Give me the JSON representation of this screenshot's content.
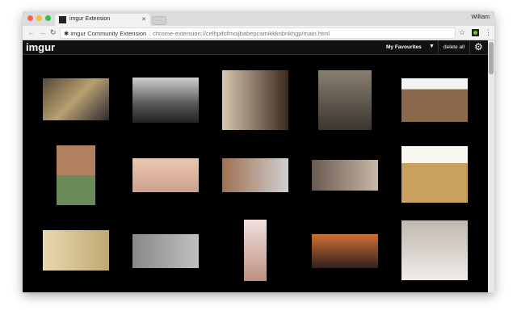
{
  "browser": {
    "tab_title": "imgur Extension",
    "user": "William",
    "site_name": "imgur Community Extension",
    "url": "chrome-extension://celhpifofmoijbabepcamikkknbnkhgp/main.html"
  },
  "header": {
    "logo": "imgur",
    "album_select": "My Favourites",
    "delete_label": "delete all"
  },
  "colors": {
    "background": "#000000",
    "header": "#111111"
  },
  "gallery": [
    {
      "fill": "linear-gradient(135deg,#5a4a3a,#b8a070,#2a2a30)"
    },
    {
      "fill": "linear-gradient(180deg,#cfcfcf,#555 60%,#222)"
    },
    {
      "fill": "linear-gradient(90deg,#d8c8b0,#3a2a20)"
    },
    {
      "fill": "linear-gradient(180deg,#8a8070,#3a3530)"
    },
    {
      "fill": "linear-gradient(180deg,#f4f4f4 25%,#8a6a4a 25%)"
    },
    {
      "fill": "linear-gradient(180deg,#b08060 50%,#6a8a5a 50%)"
    },
    {
      "fill": "linear-gradient(180deg,#e8c8b0,#d0a090)"
    },
    {
      "fill": "linear-gradient(90deg,#a07050,#d0d0d0)"
    },
    {
      "fill": "linear-gradient(90deg,#6a5a50,#c8b8a8)"
    },
    {
      "fill": "linear-gradient(180deg,#f8f8f0 30%,#c8a060 30%)"
    },
    {
      "fill": "linear-gradient(90deg,#e8d8b0,#c0a870)"
    },
    {
      "fill": "linear-gradient(90deg,#888,#c0c0c0)"
    },
    {
      "fill": "linear-gradient(180deg,#f0e0e0,#c09080)"
    },
    {
      "fill": "linear-gradient(180deg,#d07030,#302020)"
    },
    {
      "fill": "linear-gradient(180deg,#c0b8b0,#f0ece8)"
    }
  ]
}
